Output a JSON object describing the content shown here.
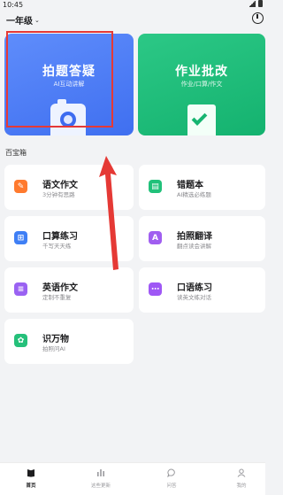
{
  "status_bar": {
    "time": "10:45"
  },
  "header": {
    "grade": "一年级"
  },
  "hero": [
    {
      "title": "拍题答疑",
      "subtitle": "AI互动讲解",
      "color": "#4a78f5"
    },
    {
      "title": "作业批改",
      "subtitle": "作业/口算/作文",
      "color": "#1dbb79"
    }
  ],
  "section": {
    "title": "百宝箱"
  },
  "tools": [
    {
      "name": "语文作文",
      "desc": "3分钟有思路",
      "icon": "pencil-icon",
      "color": "#ff7a2e",
      "glyph": "✎"
    },
    {
      "name": "错题本",
      "desc": "AI精选必练题",
      "icon": "notebook-icon",
      "color": "#21c17a",
      "glyph": "▤"
    },
    {
      "name": "口算练习",
      "desc": "千写天天练",
      "icon": "calculator-icon",
      "color": "#3f7ff5",
      "glyph": "⊞"
    },
    {
      "name": "拍照翻译",
      "desc": "翻点读会讲解",
      "icon": "translate-icon",
      "color": "#a05ef0",
      "glyph": "A"
    },
    {
      "name": "英语作文",
      "desc": "定制不重复",
      "icon": "document-icon",
      "color": "#9a62f2",
      "glyph": "≡"
    },
    {
      "name": "口语练习",
      "desc": "读英文练对话",
      "icon": "chat-icon",
      "color": "#9f58f5",
      "glyph": "⋯"
    },
    {
      "name": "识万物",
      "desc": "拍照问AI",
      "icon": "flower-icon",
      "color": "#25c07a",
      "glyph": "✿"
    }
  ],
  "tab_bar": [
    {
      "label": "首页",
      "icon": "book-icon",
      "active": true
    },
    {
      "label": "这些更新",
      "icon": "chart-icon",
      "active": false
    },
    {
      "label": "问答",
      "icon": "chat-bubble-icon",
      "active": false
    },
    {
      "label": "我的",
      "icon": "profile-icon",
      "active": false
    }
  ]
}
